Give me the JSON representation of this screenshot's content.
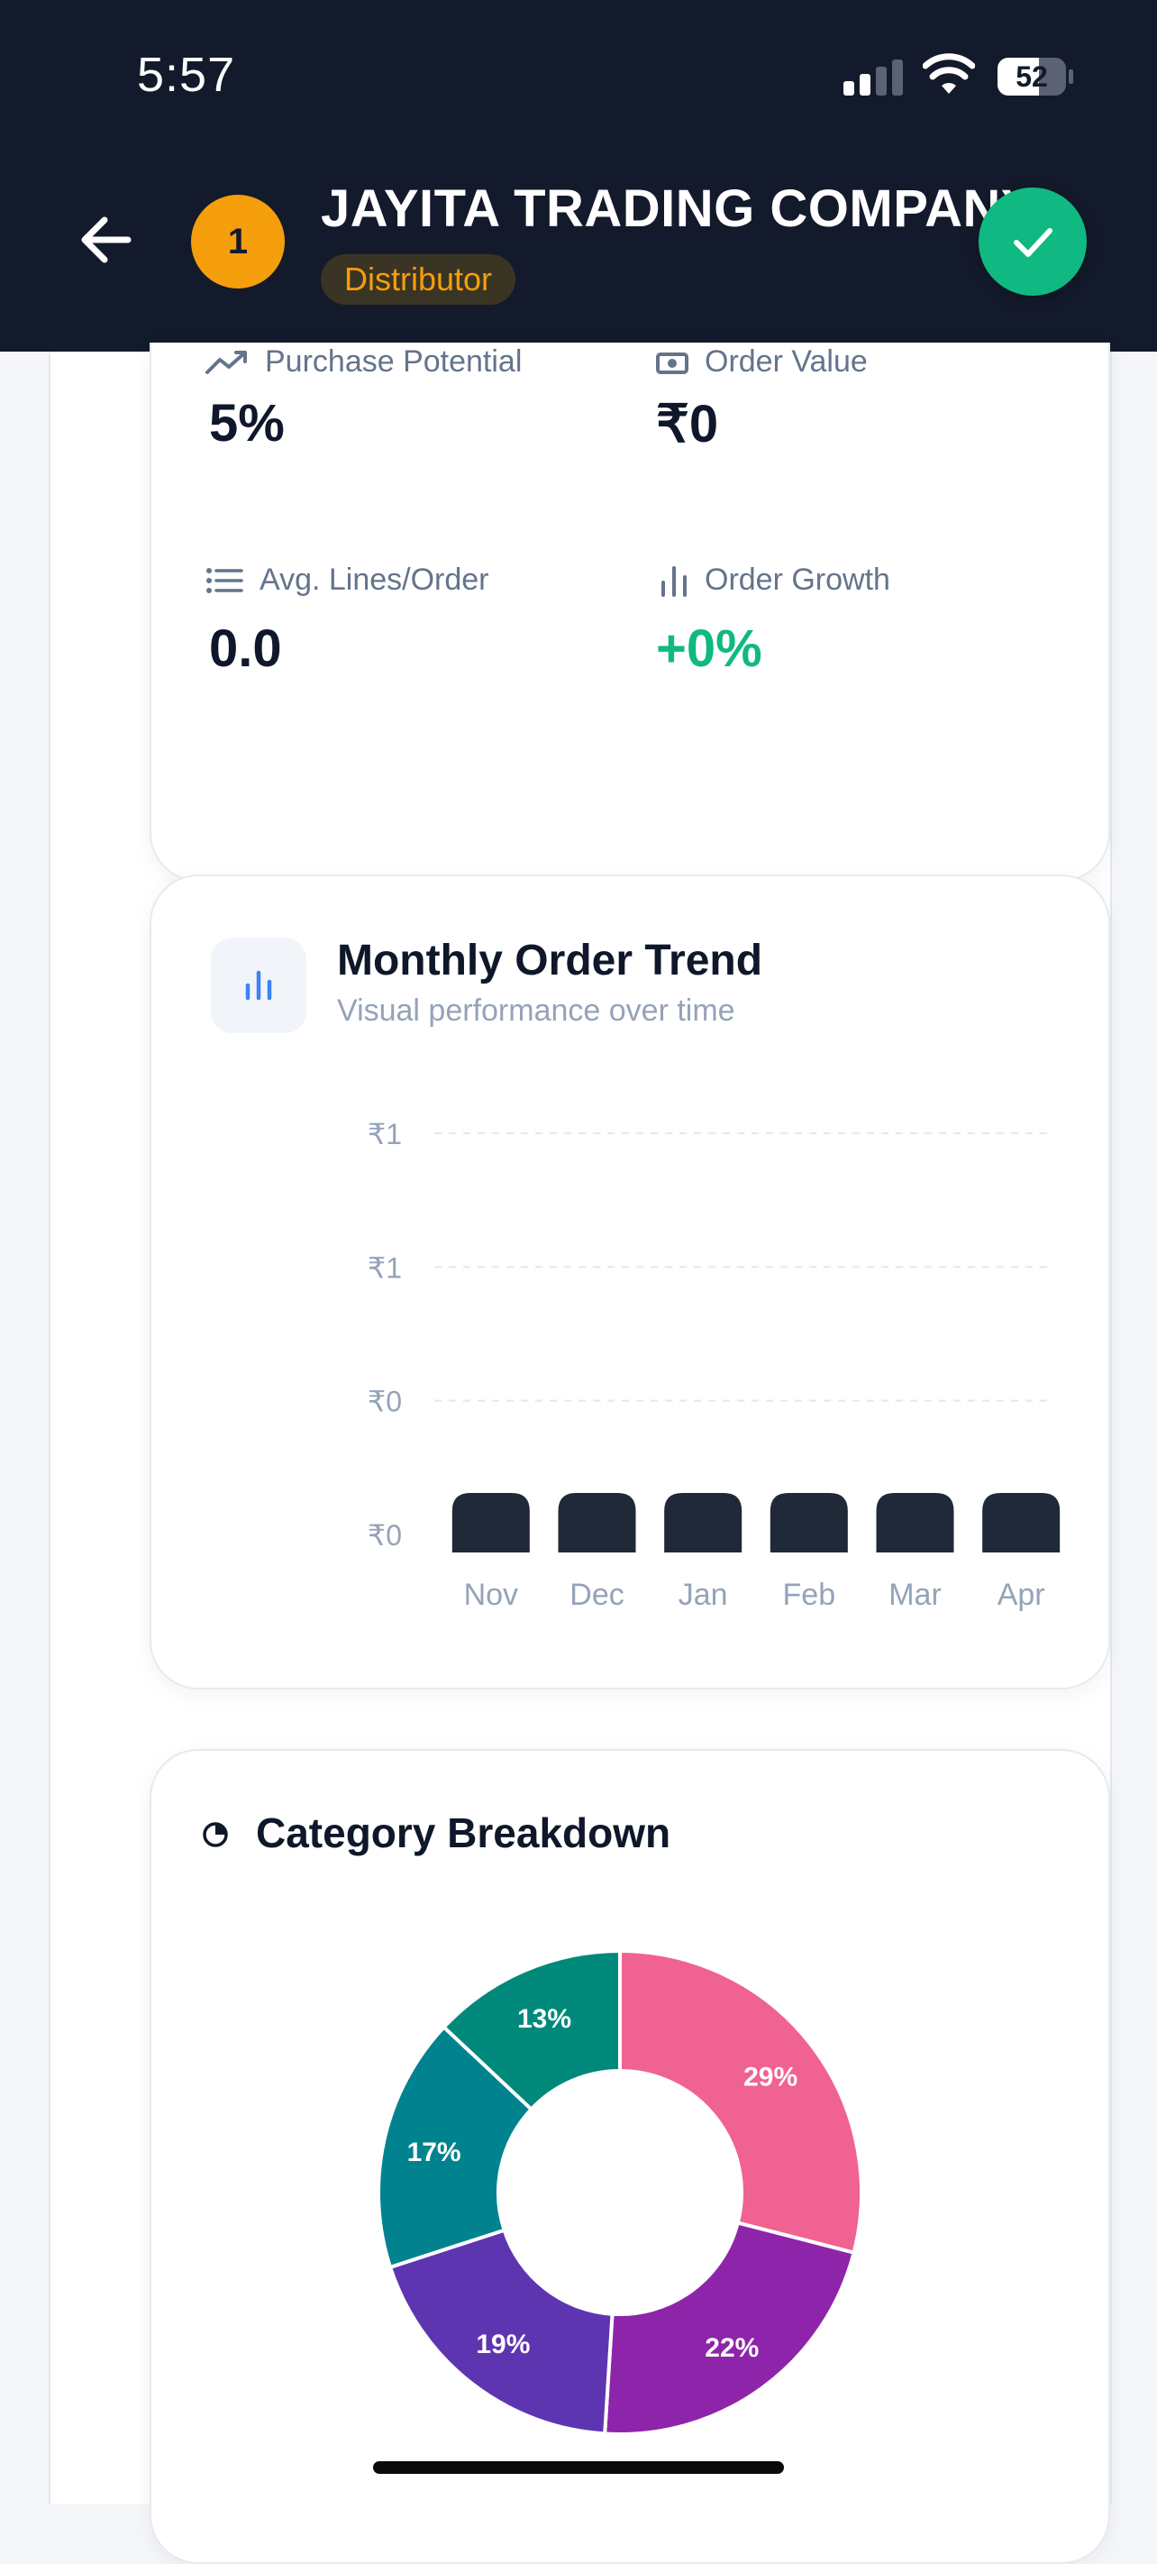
{
  "status_bar": {
    "time": "5:57",
    "battery": "52"
  },
  "header": {
    "back_icon": "arrow-left-icon",
    "badge_number": "1",
    "company_name": "JAYITA TRADING COMPANY",
    "role": "Distributor",
    "confirm_icon": "check-icon"
  },
  "stats": [
    {
      "label": "Purchase Potential",
      "value": "5%",
      "icon": "trend-up-icon"
    },
    {
      "label": "Order Value",
      "value": "₹0",
      "icon": "cash-icon"
    },
    {
      "label": "Avg. Lines/Order",
      "value": "0.0",
      "icon": "list-icon"
    },
    {
      "label": "Order Growth",
      "value": "+0%",
      "icon": "bar-chart-icon"
    }
  ],
  "trend_card": {
    "title": "Monthly Order Trend",
    "subtitle": "Visual performance over time",
    "icon": "bar-chart-icon"
  },
  "category_card": {
    "title": "Category Breakdown",
    "icon": "pie-icon"
  },
  "chart_data": [
    {
      "type": "bar",
      "title": "Monthly Order Trend",
      "categories": [
        "Nov",
        "Dec",
        "Jan",
        "Feb",
        "Mar",
        "Apr"
      ],
      "values": [
        0,
        0,
        0,
        0,
        0,
        0
      ],
      "y_tick_labels": [
        "₹1",
        "₹1",
        "₹0",
        "₹0"
      ],
      "ylim": [
        0,
        1
      ],
      "grid": true,
      "bar_color": "#1f2937"
    },
    {
      "type": "pie",
      "title": "Category Breakdown",
      "donut": true,
      "slices": [
        {
          "label": "29%",
          "value": 29,
          "color": "#f06292"
        },
        {
          "label": "22%",
          "value": 22,
          "color": "#8e24aa"
        },
        {
          "label": "19%",
          "value": 19,
          "color": "#5e35b1"
        },
        {
          "label": "17%",
          "value": 17,
          "color": "#00838f"
        },
        {
          "label": "13%",
          "value": 13,
          "color": "#00897b"
        }
      ]
    }
  ]
}
